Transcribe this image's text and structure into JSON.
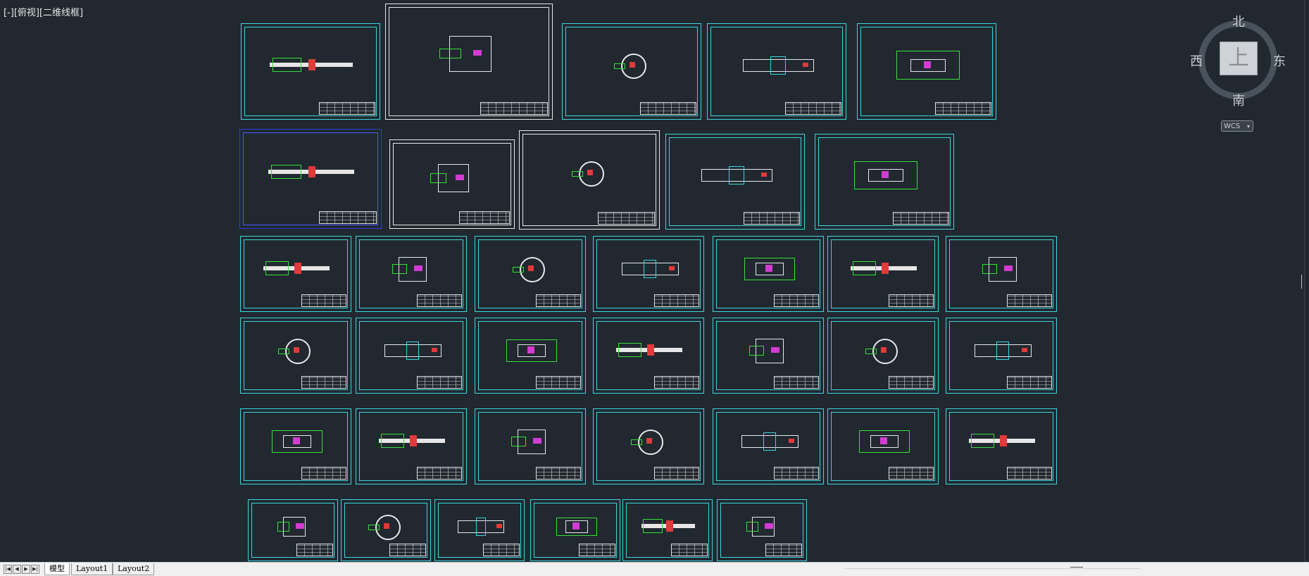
{
  "viewport": {
    "view_label": "[-][俯视][二维线框]",
    "background": "#212830",
    "sheet_color": "#3cd6dc"
  },
  "viewcube": {
    "north": "北",
    "south": "南",
    "west": "西",
    "east": "东",
    "top_face": "上",
    "wcs_label": "WCS",
    "icon": "chevron-down-icon"
  },
  "layout_tabs": [
    {
      "label": "模型",
      "active": true
    },
    {
      "label": "Layout1",
      "active": false
    },
    {
      "label": "Layout2",
      "active": false
    }
  ],
  "nav_icons": [
    "first-tab-icon",
    "prev-tab-icon",
    "next-tab-icon",
    "last-tab-icon"
  ]
}
